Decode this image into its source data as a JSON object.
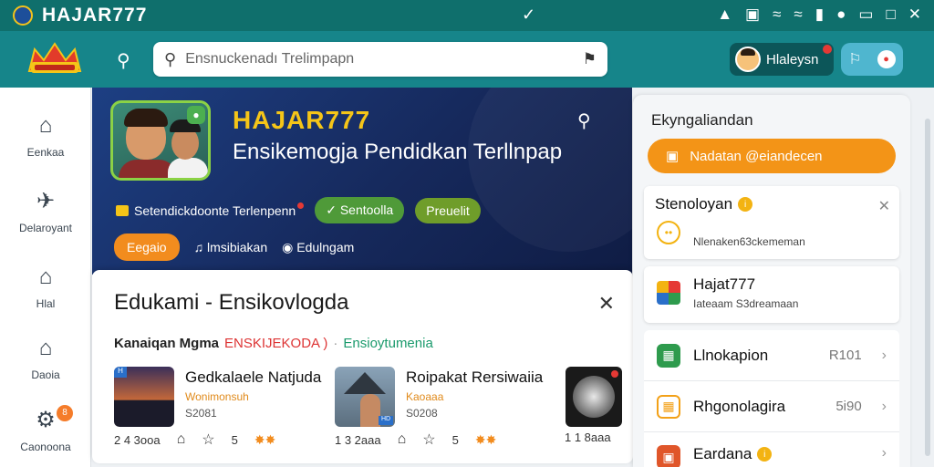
{
  "statusbar": {
    "title": "HAJAR777",
    "check": "✓",
    "icons": [
      "lock-icon",
      "cast-icon",
      "wifi-icon",
      "wifi-icon",
      "signal-icon",
      "vpn-icon",
      "battery-icon",
      "window-icon",
      "close-icon"
    ]
  },
  "appbar": {
    "search_placeholder": "Ensnuckenadı Trelimpapn",
    "user_name": "Hlaleysn"
  },
  "nav": [
    {
      "icon": "bank-icon",
      "label": "Eenkaa"
    },
    {
      "icon": "plane-icon",
      "label": "Delaroyant"
    },
    {
      "icon": "home-icon",
      "label": "Hlal"
    },
    {
      "icon": "house-icon",
      "label": "Daoia"
    },
    {
      "icon": "gear-icon",
      "label": "Caonoona",
      "badge": "8"
    }
  ],
  "hero": {
    "brand": "HAJAR777",
    "subtitle": "Ensikemogja Pendidkan Terllnpap",
    "tagline": "Setendickdoonte Terlenpenn",
    "pill1": "Sentoolla",
    "pill2": "Preuelit",
    "orange_btn": "Eegaio",
    "link1": "lmsibiakan",
    "link2": "Edulngam"
  },
  "card": {
    "title": "Edukami - Ensikovlogda",
    "crumb1": "Kanaiqan Mgma",
    "crumb2": "ENSKIJEKODA )",
    "crumb3": "Ensioytumenia",
    "games": [
      {
        "title": "Gedkalaele Natjuda",
        "sub": "Wonimonsuh",
        "num": "S2081",
        "stat": "2 4 3ooa",
        "rating": "5"
      },
      {
        "title": "Roipakat Rersiwaiia",
        "sub": "Kaoaaa",
        "num": "S0208",
        "stat": "1 3 2aaa",
        "rating": "5"
      },
      {
        "stat": "1 1 8aaa"
      }
    ]
  },
  "right": {
    "heading": "Ekyngaliandan",
    "cta": "Nadatan @eiandecen",
    "card1_title": "Stenoloyan",
    "card1_sub": "Nlenaken63ckememan",
    "card2_title": "Hajat777",
    "card2_sub": "Iateaam S3dreamaan",
    "rows": [
      {
        "label": "Llnokapion",
        "value": "R101",
        "color": "#2e9b4d"
      },
      {
        "label": "Rhgonolagira",
        "value": "5i90",
        "color": "#f3a118"
      },
      {
        "label": "Eardana",
        "value": "",
        "color": "#e0562a",
        "info": true
      }
    ]
  }
}
